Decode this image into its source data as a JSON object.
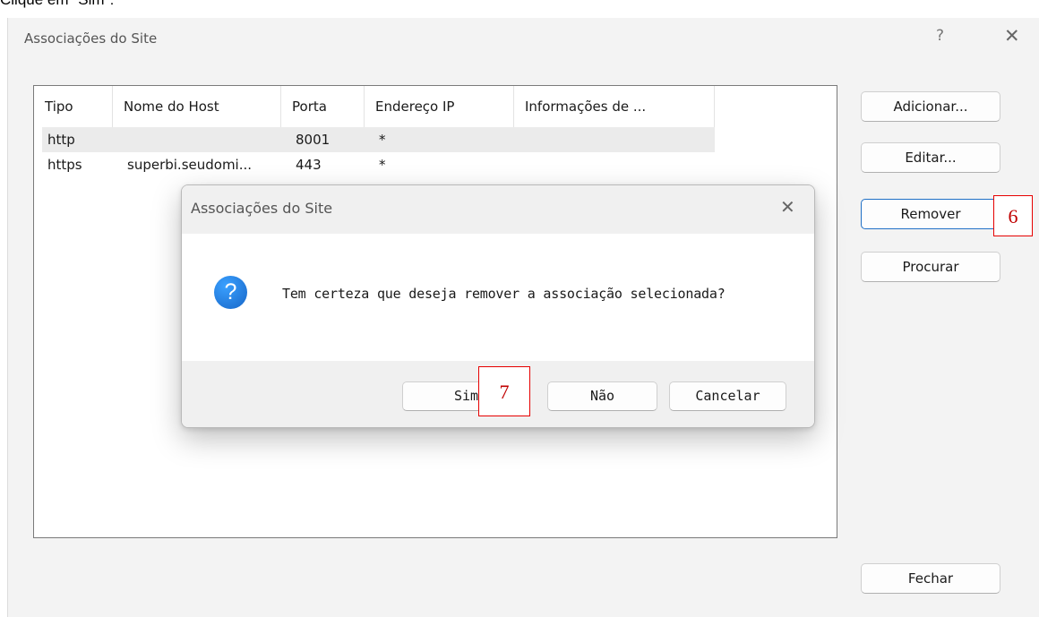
{
  "caption": "Clique em \"Sim\":",
  "window": {
    "title": "Associações do Site",
    "help_glyph": "?",
    "close_glyph": "✕"
  },
  "table": {
    "columns": [
      "Tipo",
      "Nome do Host",
      "Porta",
      "Endereço IP",
      "Informações de ..."
    ],
    "rows": [
      [
        "http",
        "",
        "8001",
        "*",
        ""
      ],
      [
        "https",
        "superbi.seudomi...",
        "443",
        "*",
        ""
      ]
    ]
  },
  "buttons": {
    "add": "Adicionar...",
    "edit": "Editar...",
    "remove": "Remover",
    "browse": "Procurar",
    "close": "Fechar"
  },
  "dialog": {
    "title": "Associações do Site",
    "close_glyph": "✕",
    "icon": "question-icon",
    "icon_glyph": "?",
    "message": "Tem certeza que deseja remover a associação selecionada?",
    "buttons": {
      "yes": "Sim",
      "no": "Não",
      "cancel": "Cancelar"
    }
  },
  "markers": {
    "remove_step": "6",
    "yes_step": "7"
  },
  "colors": {
    "accent": "#1f6fc5",
    "marker": "#e60000",
    "icon": "#1e7ae0"
  }
}
